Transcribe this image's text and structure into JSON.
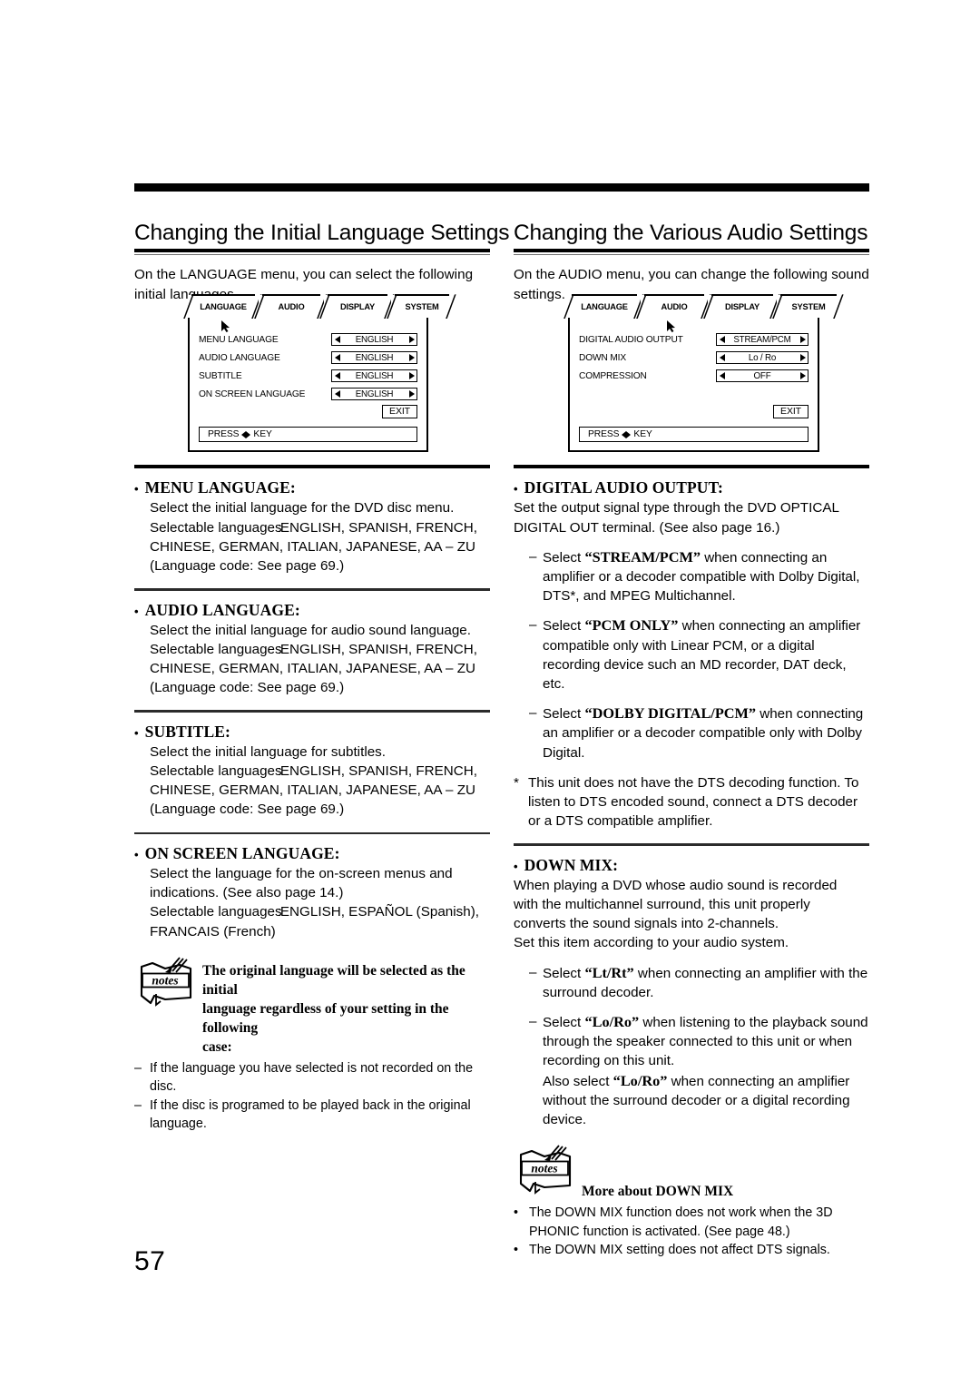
{
  "page": {
    "number": "57"
  },
  "left_column": {
    "title": "Changing the Initial Language Settings",
    "intro": "On the LANGUAGE menu, you can select the following initial languages.",
    "osd": {
      "tabs": [
        "LANGUAGE",
        "AUDIO",
        "DISPLAY",
        "SYSTEM"
      ],
      "active_tab": "LANGUAGE",
      "rows": [
        {
          "label": "MENU LANGUAGE",
          "value": "ENGLISH"
        },
        {
          "label": "AUDIO LANGUAGE",
          "value": "ENGLISH"
        },
        {
          "label": "SUBTITLE",
          "value": "ENGLISH"
        },
        {
          "label": "ON SCREEN LANGUAGE",
          "value": "ENGLISH"
        }
      ],
      "exit_label": "EXIT",
      "press_prefix": "PRESS",
      "press_suffix": "KEY"
    },
    "sections": [
      {
        "heading": "MENU LANGUAGE:",
        "line1": "Select the initial language for the DVD disc menu.",
        "sel_prefix": "Selectable languages",
        "sel_colon": ":",
        "sel_line1": "ENGLISH, SPANISH, FRENCH,",
        "sel_line2": "CHINESE, GERMAN, ITALIAN, JAPANESE, AA – ZU",
        "note": "(Language code: See page 69.)"
      },
      {
        "heading": "AUDIO LANGUAGE:",
        "line1": "Select the initial language for audio sound language.",
        "sel_prefix": "Selectable languages",
        "sel_colon": ":",
        "sel_line1": "ENGLISH, SPANISH, FRENCH,",
        "sel_line2": "CHINESE, GERMAN, ITALIAN, JAPANESE, AA – ZU",
        "note": "(Language code: See page 69.)"
      },
      {
        "heading": "SUBTITLE:",
        "line1": "Select the initial language for subtitles.",
        "sel_prefix": "Selectable languages",
        "sel_colon": ":",
        "sel_line1": "ENGLISH, SPANISH, FRENCH,",
        "sel_line2": "CHINESE, GERMAN, ITALIAN, JAPANESE, AA – ZU",
        "note": "(Language code: See page 69.)"
      },
      {
        "heading": "ON SCREEN LANGUAGE:",
        "line1": "Select the language for the on-screen menus and",
        "line2": "indications. (See also page 14.)",
        "sel_prefix": "Selectable languages",
        "sel_colon": ":",
        "sel_line1": "ENGLISH, ESPAÑOL (Spanish),",
        "sel_line2": "FRANCAIS (French)"
      }
    ],
    "notes": {
      "icon_label": "notes",
      "heading_l1": "The original language will be selected as the initial",
      "heading_l2": "language regardless of your setting in the following",
      "heading_l3": "case:",
      "items": [
        {
          "marker": "–",
          "text": "If the language you have selected is not recorded on the disc."
        },
        {
          "marker": "–",
          "text": "If the disc is programed to be played back in the original language."
        }
      ]
    }
  },
  "right_column": {
    "title": "Changing the Various Audio Settings",
    "intro": "On the AUDIO menu, you can change the following sound settings.",
    "osd": {
      "tabs": [
        "LANGUAGE",
        "AUDIO",
        "DISPLAY",
        "SYSTEM"
      ],
      "active_tab": "AUDIO",
      "rows": [
        {
          "label": "DIGITAL AUDIO OUTPUT",
          "value": "STREAM/PCM"
        },
        {
          "label": "DOWN MIX",
          "value": "Lo / Ro"
        },
        {
          "label": "COMPRESSION",
          "value": "OFF"
        }
      ],
      "exit_label": "EXIT",
      "press_prefix": "PRESS",
      "press_suffix": "KEY"
    },
    "digital_audio_output": {
      "heading": "DIGITAL AUDIO OUTPUT:",
      "line1": "Set the output signal type through the DVD OPTICAL",
      "line2": "DIGITAL OUT terminal. (See also page 16.)",
      "bullets": [
        {
          "marker": "–",
          "pre": "Select ",
          "bold": "“STREAM/PCM”",
          "post": " when connecting an amplifier or a decoder compatible with Dolby Digital, DTS*, and MPEG Multichannel."
        },
        {
          "marker": "–",
          "pre": "Select ",
          "bold": "“PCM ONLY”",
          "post": " when connecting an amplifier compatible only with Linear PCM, or a digital recording device such an MD recorder, DAT deck, etc."
        },
        {
          "marker": "–",
          "pre": "Select ",
          "bold": "“DOLBY DIGITAL/PCM”",
          "post": " when connecting an amplifier or a decoder compatible only with Dolby Digital."
        }
      ],
      "footnote": {
        "marker": "*",
        "text": "This unit does not have the DTS decoding function. To listen to DTS encoded sound, connect a DTS decoder or a DTS compatible amplifier."
      }
    },
    "down_mix": {
      "heading": "DOWN MIX:",
      "line1": "When playing a DVD whose audio sound is recorded",
      "line2": "with the multichannel surround, this unit properly",
      "line3": "converts the sound signals into 2-channels.",
      "line4": "Set this item according to your audio system.",
      "bullets": [
        {
          "marker": "–",
          "pre": "Select ",
          "bold": "“Lt/Rt”",
          "post": " when connecting an amplifier with the surround decoder."
        },
        {
          "marker": "–",
          "pre": "Select ",
          "bold": "“Lo/Ro”",
          "post": " when listening to the playback sound through the speaker connected to this unit or when recording on this unit.",
          "pre2": "Also select ",
          "bold2": "“Lo/Ro”",
          "post2": " when connecting an amplifier without the surround decoder or a digital recording device."
        }
      ]
    },
    "notes": {
      "icon_label": "notes",
      "heading": "More about DOWN MIX",
      "items": [
        {
          "marker": "•",
          "text": "The DOWN MIX function does not work when the 3D PHONIC function is activated. (See page 48.)"
        },
        {
          "marker": "•",
          "text": "The DOWN MIX setting does not affect DTS signals."
        }
      ]
    }
  }
}
